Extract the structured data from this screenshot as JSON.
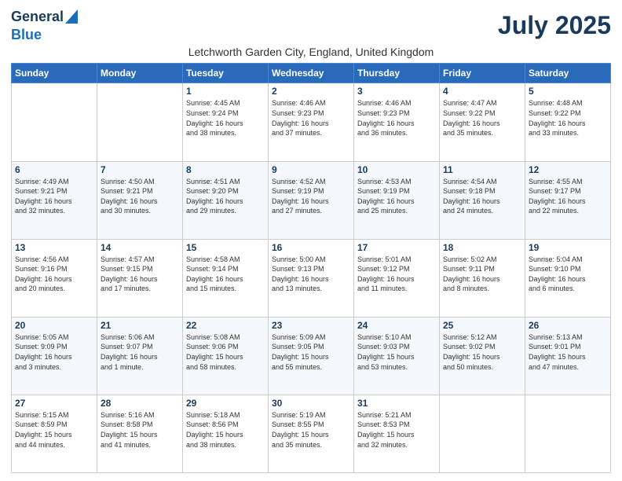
{
  "header": {
    "logo_line1": "General",
    "logo_line2": "Blue",
    "title": "July 2025",
    "subtitle": "Letchworth Garden City, England, United Kingdom"
  },
  "days_of_week": [
    "Sunday",
    "Monday",
    "Tuesday",
    "Wednesday",
    "Thursday",
    "Friday",
    "Saturday"
  ],
  "weeks": [
    [
      {
        "day": "",
        "info": ""
      },
      {
        "day": "",
        "info": ""
      },
      {
        "day": "1",
        "info": "Sunrise: 4:45 AM\nSunset: 9:24 PM\nDaylight: 16 hours\nand 38 minutes."
      },
      {
        "day": "2",
        "info": "Sunrise: 4:46 AM\nSunset: 9:23 PM\nDaylight: 16 hours\nand 37 minutes."
      },
      {
        "day": "3",
        "info": "Sunrise: 4:46 AM\nSunset: 9:23 PM\nDaylight: 16 hours\nand 36 minutes."
      },
      {
        "day": "4",
        "info": "Sunrise: 4:47 AM\nSunset: 9:22 PM\nDaylight: 16 hours\nand 35 minutes."
      },
      {
        "day": "5",
        "info": "Sunrise: 4:48 AM\nSunset: 9:22 PM\nDaylight: 16 hours\nand 33 minutes."
      }
    ],
    [
      {
        "day": "6",
        "info": "Sunrise: 4:49 AM\nSunset: 9:21 PM\nDaylight: 16 hours\nand 32 minutes."
      },
      {
        "day": "7",
        "info": "Sunrise: 4:50 AM\nSunset: 9:21 PM\nDaylight: 16 hours\nand 30 minutes."
      },
      {
        "day": "8",
        "info": "Sunrise: 4:51 AM\nSunset: 9:20 PM\nDaylight: 16 hours\nand 29 minutes."
      },
      {
        "day": "9",
        "info": "Sunrise: 4:52 AM\nSunset: 9:19 PM\nDaylight: 16 hours\nand 27 minutes."
      },
      {
        "day": "10",
        "info": "Sunrise: 4:53 AM\nSunset: 9:19 PM\nDaylight: 16 hours\nand 25 minutes."
      },
      {
        "day": "11",
        "info": "Sunrise: 4:54 AM\nSunset: 9:18 PM\nDaylight: 16 hours\nand 24 minutes."
      },
      {
        "day": "12",
        "info": "Sunrise: 4:55 AM\nSunset: 9:17 PM\nDaylight: 16 hours\nand 22 minutes."
      }
    ],
    [
      {
        "day": "13",
        "info": "Sunrise: 4:56 AM\nSunset: 9:16 PM\nDaylight: 16 hours\nand 20 minutes."
      },
      {
        "day": "14",
        "info": "Sunrise: 4:57 AM\nSunset: 9:15 PM\nDaylight: 16 hours\nand 17 minutes."
      },
      {
        "day": "15",
        "info": "Sunrise: 4:58 AM\nSunset: 9:14 PM\nDaylight: 16 hours\nand 15 minutes."
      },
      {
        "day": "16",
        "info": "Sunrise: 5:00 AM\nSunset: 9:13 PM\nDaylight: 16 hours\nand 13 minutes."
      },
      {
        "day": "17",
        "info": "Sunrise: 5:01 AM\nSunset: 9:12 PM\nDaylight: 16 hours\nand 11 minutes."
      },
      {
        "day": "18",
        "info": "Sunrise: 5:02 AM\nSunset: 9:11 PM\nDaylight: 16 hours\nand 8 minutes."
      },
      {
        "day": "19",
        "info": "Sunrise: 5:04 AM\nSunset: 9:10 PM\nDaylight: 16 hours\nand 6 minutes."
      }
    ],
    [
      {
        "day": "20",
        "info": "Sunrise: 5:05 AM\nSunset: 9:09 PM\nDaylight: 16 hours\nand 3 minutes."
      },
      {
        "day": "21",
        "info": "Sunrise: 5:06 AM\nSunset: 9:07 PM\nDaylight: 16 hours\nand 1 minute."
      },
      {
        "day": "22",
        "info": "Sunrise: 5:08 AM\nSunset: 9:06 PM\nDaylight: 15 hours\nand 58 minutes."
      },
      {
        "day": "23",
        "info": "Sunrise: 5:09 AM\nSunset: 9:05 PM\nDaylight: 15 hours\nand 55 minutes."
      },
      {
        "day": "24",
        "info": "Sunrise: 5:10 AM\nSunset: 9:03 PM\nDaylight: 15 hours\nand 53 minutes."
      },
      {
        "day": "25",
        "info": "Sunrise: 5:12 AM\nSunset: 9:02 PM\nDaylight: 15 hours\nand 50 minutes."
      },
      {
        "day": "26",
        "info": "Sunrise: 5:13 AM\nSunset: 9:01 PM\nDaylight: 15 hours\nand 47 minutes."
      }
    ],
    [
      {
        "day": "27",
        "info": "Sunrise: 5:15 AM\nSunset: 8:59 PM\nDaylight: 15 hours\nand 44 minutes."
      },
      {
        "day": "28",
        "info": "Sunrise: 5:16 AM\nSunset: 8:58 PM\nDaylight: 15 hours\nand 41 minutes."
      },
      {
        "day": "29",
        "info": "Sunrise: 5:18 AM\nSunset: 8:56 PM\nDaylight: 15 hours\nand 38 minutes."
      },
      {
        "day": "30",
        "info": "Sunrise: 5:19 AM\nSunset: 8:55 PM\nDaylight: 15 hours\nand 35 minutes."
      },
      {
        "day": "31",
        "info": "Sunrise: 5:21 AM\nSunset: 8:53 PM\nDaylight: 15 hours\nand 32 minutes."
      },
      {
        "day": "",
        "info": ""
      },
      {
        "day": "",
        "info": ""
      }
    ]
  ]
}
